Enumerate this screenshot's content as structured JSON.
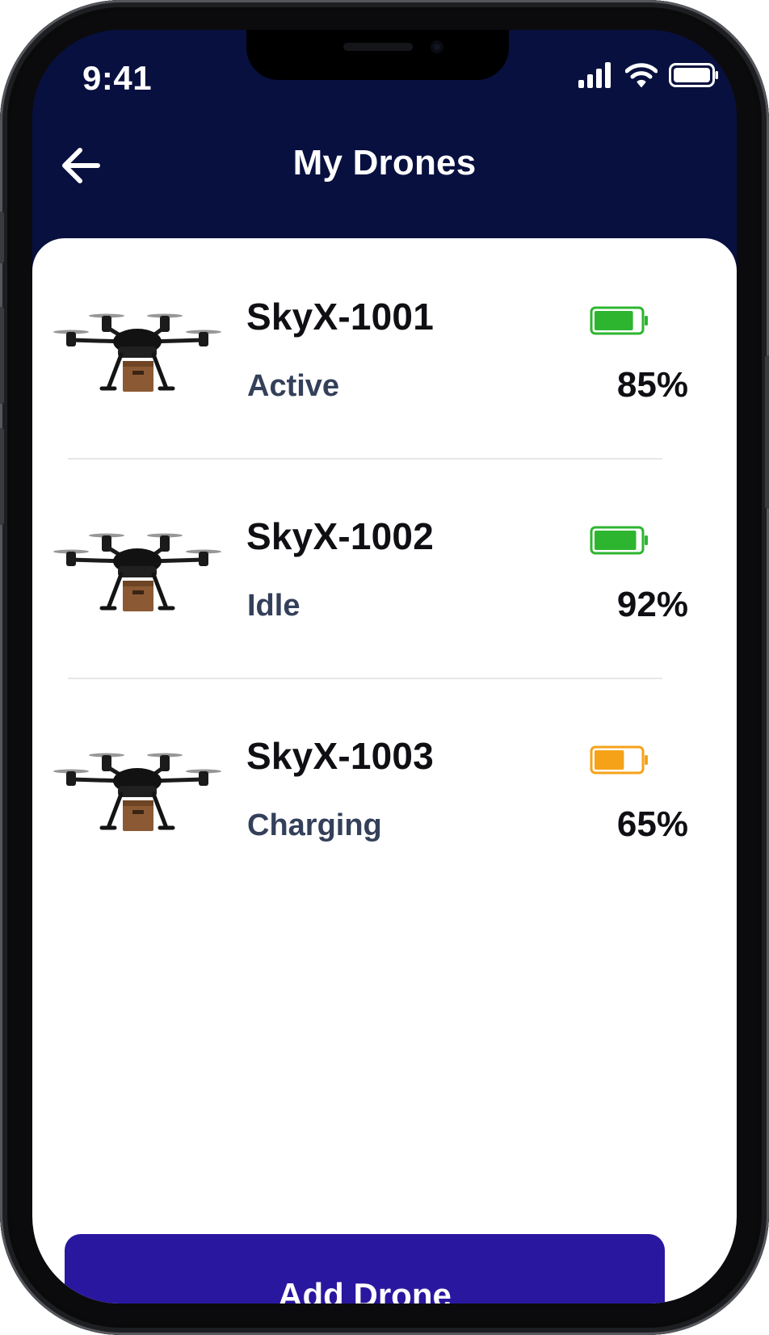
{
  "status_bar": {
    "time": "9:41",
    "icons": [
      "cellular-signal-icon",
      "wifi-icon",
      "battery-icon"
    ]
  },
  "header": {
    "title": "My Drones",
    "back_icon": "arrow-left-icon"
  },
  "drones": [
    {
      "name": "SkyX-1001",
      "status": "Active",
      "battery_percent": "85%",
      "battery_level": 0.85,
      "battery_color": "#2db52f",
      "image": "delivery-drone-with-package"
    },
    {
      "name": "SkyX-1002",
      "status": "Idle",
      "battery_percent": "92%",
      "battery_level": 0.92,
      "battery_color": "#2db52f",
      "image": "delivery-drone-with-package"
    },
    {
      "name": "SkyX-1003",
      "status": "Charging",
      "battery_percent": "65%",
      "battery_level": 0.65,
      "battery_color": "#f5a219",
      "image": "delivery-drone-with-package"
    }
  ],
  "actions": {
    "add_drone_label": "Add Drone"
  },
  "colors": {
    "header_bg": "#08103f",
    "primary_button": "#2a17a0",
    "status_text": "#34405a",
    "battery_good": "#2db52f",
    "battery_medium": "#f5a219"
  }
}
